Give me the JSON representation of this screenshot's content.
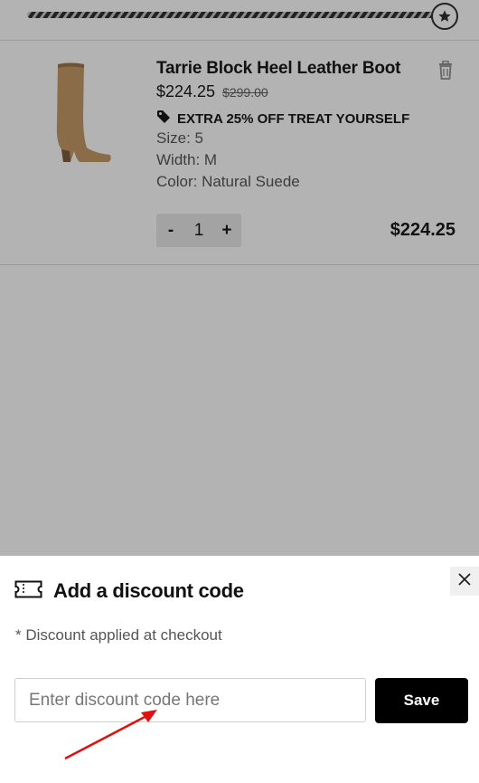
{
  "progress": {
    "fraction": 0.96
  },
  "item": {
    "name": "Tarrie Block Heel Leather Boot",
    "price": "$224.25",
    "original_price": "$299.00",
    "promo": "EXTRA 25% OFF TREAT YOURSELF",
    "size": "Size: 5",
    "width": "Width: M",
    "color": "Color: Natural Suede",
    "quantity": "1",
    "decrement_label": "-",
    "increment_label": "+",
    "line_total": "$224.25"
  },
  "discount": {
    "title": "Add a discount code",
    "note": "* Discount applied at checkout",
    "placeholder": "Enter discount code here",
    "save_label": "Save"
  },
  "colors": {
    "overlay": "#b3b3b3",
    "annotation_arrow": "#e01010",
    "button": "#000000"
  }
}
